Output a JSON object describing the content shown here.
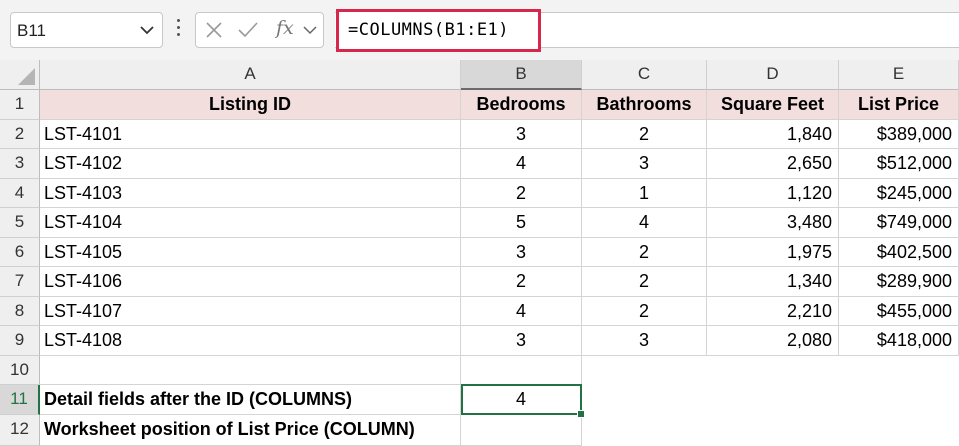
{
  "name_box": {
    "value": "B11"
  },
  "formula_bar": {
    "fx_label": "fx",
    "formula": "=COLUMNS(B1:E1)",
    "highlight_color": "#d8274d"
  },
  "columns": [
    "A",
    "B",
    "C",
    "D",
    "E"
  ],
  "rows": [
    "1",
    "2",
    "3",
    "4",
    "5",
    "6",
    "7",
    "8",
    "9",
    "10",
    "11",
    "12"
  ],
  "table": {
    "headers": [
      "Listing ID",
      "Bedrooms",
      "Bathrooms",
      "Square Feet",
      "List Price"
    ],
    "header_fill": "#f3dede",
    "data": [
      [
        "LST-4101",
        "3",
        "2",
        "1,840",
        "$389,000"
      ],
      [
        "LST-4102",
        "4",
        "3",
        "2,650",
        "$512,000"
      ],
      [
        "LST-4103",
        "2",
        "1",
        "1,120",
        "$245,000"
      ],
      [
        "LST-4104",
        "5",
        "4",
        "3,480",
        "$749,000"
      ],
      [
        "LST-4105",
        "3",
        "2",
        "1,975",
        "$402,500"
      ],
      [
        "LST-4106",
        "2",
        "2",
        "1,340",
        "$289,900"
      ],
      [
        "LST-4107",
        "4",
        "2",
        "2,210",
        "$455,000"
      ],
      [
        "LST-4108",
        "3",
        "3",
        "2,080",
        "$418,000"
      ]
    ]
  },
  "summary": [
    {
      "label": "Detail fields after the ID (COLUMNS)",
      "value": "4"
    },
    {
      "label": "Worksheet position of List Price (COLUMN)",
      "value": ""
    }
  ],
  "active_cell": "B11",
  "accent_color": "#217346"
}
